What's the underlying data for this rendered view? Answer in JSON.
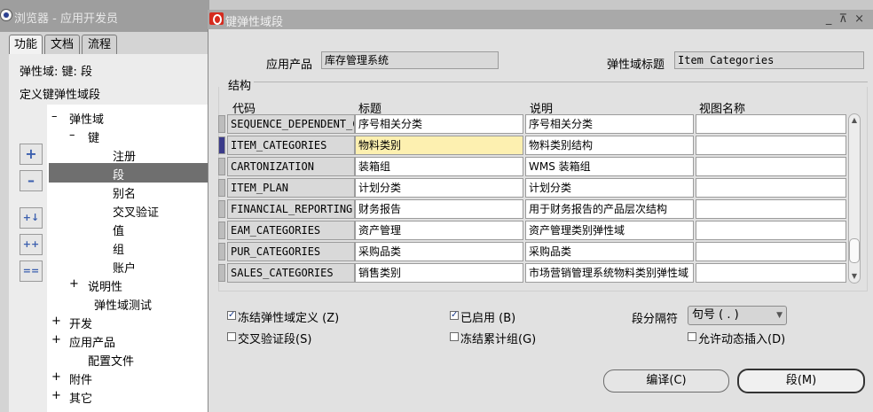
{
  "navigator": {
    "title": "浏览器 - 应用开发员",
    "tabs": [
      "功能",
      "文档",
      "流程"
    ],
    "line1": "弹性域: 键: 段",
    "line2": "定义键弹性域段",
    "tree": [
      {
        "expander": "–",
        "label": "弹性域"
      },
      {
        "expander": "–",
        "label": "键"
      },
      {
        "expander": "",
        "label": "注册"
      },
      {
        "expander": "",
        "label": "段"
      },
      {
        "expander": "",
        "label": "别名"
      },
      {
        "expander": "",
        "label": "交叉验证"
      },
      {
        "expander": "",
        "label": "值"
      },
      {
        "expander": "",
        "label": "组"
      },
      {
        "expander": "",
        "label": "账户"
      },
      {
        "expander": "+",
        "label": "说明性"
      },
      {
        "expander": "",
        "label": "弹性域测试"
      },
      {
        "expander": "+",
        "label": "开发"
      },
      {
        "expander": "+",
        "label": "应用产品"
      },
      {
        "expander": "",
        "label": "配置文件"
      },
      {
        "expander": "+",
        "label": "附件"
      },
      {
        "expander": "+",
        "label": "其它"
      }
    ],
    "side_buttons": [
      "+",
      "–",
      "+↓",
      "++",
      "=="
    ]
  },
  "dialog": {
    "title": "键弹性域段",
    "window_controls": "_ ⊼ ×",
    "app_label": "应用产品",
    "app_value": "库存管理系统",
    "title_label": "弹性域标题",
    "title_value": "Item Categories",
    "section": "结构",
    "columns": [
      "代码",
      "标题",
      "说明",
      "视图名称"
    ],
    "rows": [
      {
        "code": "SEQUENCE_DEPENDENT_C",
        "title": "序号相关分类",
        "desc": "序号相关分类",
        "view": ""
      },
      {
        "code": "ITEM_CATEGORIES",
        "title": "物料类别",
        "desc": "物料类别结构",
        "view": ""
      },
      {
        "code": "CARTONIZATION",
        "title": "装箱组",
        "desc": "WMS 装箱组",
        "view": ""
      },
      {
        "code": "ITEM_PLAN",
        "title": "计划分类",
        "desc": "计划分类",
        "view": ""
      },
      {
        "code": "FINANCIAL_REPORTING",
        "title": "财务报告",
        "desc": "用于财务报告的产品层次结构",
        "view": ""
      },
      {
        "code": "EAM_CATEGORIES",
        "title": "资产管理",
        "desc": "资产管理类别弹性域",
        "view": ""
      },
      {
        "code": "PUR_CATEGORIES",
        "title": "采购品类",
        "desc": "采购品类",
        "view": ""
      },
      {
        "code": "SALES_CATEGORIES",
        "title": "销售类别",
        "desc": "市场营销管理系统物料类别弹性域",
        "view": ""
      }
    ],
    "checkboxes": {
      "freeze": {
        "label": "冻结弹性域定义 (Z)",
        "checked": true
      },
      "enabled": {
        "label": "已启用 (B)",
        "checked": true
      },
      "cross_validate": {
        "label": "交叉验证段(S)",
        "checked": false
      },
      "freeze_rollup": {
        "label": "冻结累计组(G)",
        "checked": false
      },
      "dynamic_insert": {
        "label": "允许动态插入(D)",
        "checked": false
      }
    },
    "separator_label": "段分隔符",
    "separator_value": "句号 ( . )",
    "buttons": {
      "compile": "编译(C)",
      "segments": "段(M)"
    }
  }
}
